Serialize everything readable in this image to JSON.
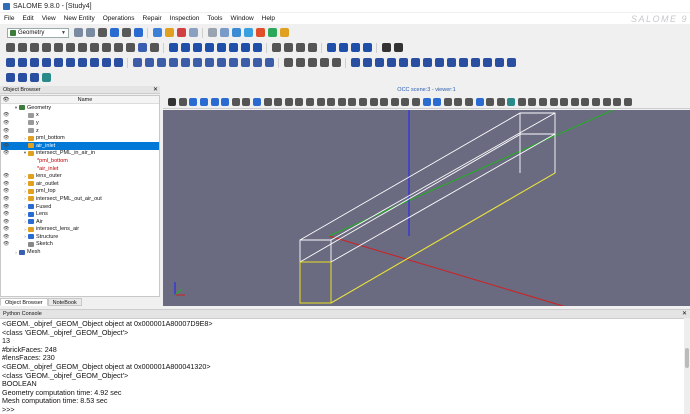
{
  "window": {
    "title": "SALOME 9.8.0 - [Study4]",
    "logo_text": "SALOME 9"
  },
  "menu": [
    "File",
    "Edit",
    "View",
    "New Entity",
    "Operations",
    "Repair",
    "Inspection",
    "Tools",
    "Window",
    "Help"
  ],
  "module_selector": {
    "value": "Geometry"
  },
  "toolbar_rows": [
    [
      "#7a8aa0",
      "#7a8aa0",
      "#5a5a5a",
      "#2a6bd1",
      "#5a5a5a",
      "#2a6bd1",
      "sep",
      "#3c7fd6",
      "#e0a020",
      "#d04040",
      "#8aa0c0",
      "sep",
      "#9aa3b0",
      "#7a9ac8",
      "#3b8bd4",
      "#3aa0e0",
      "#e04f2a",
      "#2ca85a",
      "#e0a020"
    ],
    [
      "#555",
      "#555",
      "#555",
      "#555",
      "#555",
      "#555",
      "#555",
      "#555",
      "#555",
      "#555",
      "#555",
      "#3a5fb0",
      "#555",
      "sep",
      "#1f4fa8",
      "#1f4fa8",
      "#1f4fa8",
      "#1f4fa8",
      "#1f4fa8",
      "#1f4fa8",
      "#1f4fa8",
      "#1f4fa8",
      "sep",
      "#555",
      "#555",
      "#555",
      "#555",
      "sep",
      "#1f4fa8",
      "#1f4fa8",
      "#1f4fa8",
      "#1f4fa8",
      "sep",
      "#333",
      "#333"
    ],
    [
      "#2a4fa0",
      "#2a4fa0",
      "#2a4fa0",
      "#2a4fa0",
      "#2a4fa0",
      "#2a4fa0",
      "#2a4fa0",
      "#2a4fa0",
      "#2a4fa0",
      "#2a4fa0",
      "sep",
      "#3d5da8",
      "#3d5da8",
      "#3d5da8",
      "#3d5da8",
      "#3d5da8",
      "#3d5da8",
      "#3d5da8",
      "#3d5da8",
      "#3d5da8",
      "#3d5da8",
      "#3d5da8",
      "#3d5da8",
      "sep",
      "#555",
      "#555",
      "#555",
      "#555",
      "#555",
      "sep",
      "#2a4fa0",
      "#2a4fa0",
      "#2a4fa0",
      "#2a4fa0",
      "#2a4fa0",
      "#2a4fa0",
      "#2a4fa0",
      "#2a4fa0",
      "#2a4fa0",
      "#2a4fa0",
      "#2a4fa0",
      "#2a4fa0",
      "#2a4fa0",
      "#2a4fa0"
    ],
    [
      "#2a4fa0",
      "#2a4fa0",
      "#2a4fa0",
      "#2a8a8a"
    ]
  ],
  "object_browser": {
    "title": "Object Browser",
    "column_name": "Name",
    "rows": [
      {
        "label": "Geometry",
        "indent": 0,
        "arrow": "▾",
        "eye": "",
        "icon": "#3b7c3b",
        "selected": false,
        "red": false
      },
      {
        "label": "x",
        "indent": 1,
        "arrow": "",
        "eye": "👁",
        "icon": "#9a9a9a",
        "selected": false,
        "red": false
      },
      {
        "label": "y",
        "indent": 1,
        "arrow": "",
        "eye": "👁",
        "icon": "#9a9a9a",
        "selected": false,
        "red": false
      },
      {
        "label": "z",
        "indent": 1,
        "arrow": "",
        "eye": "👁",
        "icon": "#9a9a9a",
        "selected": false,
        "red": false
      },
      {
        "label": "pml_bottom",
        "indent": 1,
        "arrow": "›",
        "eye": "👁",
        "icon": "#e0a020",
        "selected": false,
        "red": false
      },
      {
        "label": "air_inlet",
        "indent": 1,
        "arrow": "›",
        "eye": "👁",
        "icon": "#e0a020",
        "selected": true,
        "red": false
      },
      {
        "label": "intersect_PML_in_air_in",
        "indent": 1,
        "arrow": "▾",
        "eye": "👁",
        "icon": "#e0a020",
        "selected": false,
        "red": false
      },
      {
        "label": "pml_bottom",
        "indent": 2,
        "arrow": "",
        "eye": "",
        "icon": "",
        "selected": false,
        "red": true
      },
      {
        "label": "air_inlet",
        "indent": 2,
        "arrow": "",
        "eye": "",
        "icon": "",
        "selected": false,
        "red": true
      },
      {
        "label": "lens_outer",
        "indent": 1,
        "arrow": "›",
        "eye": "👁",
        "icon": "#e0a020",
        "selected": false,
        "red": false
      },
      {
        "label": "air_outlet",
        "indent": 1,
        "arrow": "›",
        "eye": "👁",
        "icon": "#e0a020",
        "selected": false,
        "red": false
      },
      {
        "label": "pml_top",
        "indent": 1,
        "arrow": "›",
        "eye": "👁",
        "icon": "#e0a020",
        "selected": false,
        "red": false
      },
      {
        "label": "intersect_PML_out_air_out",
        "indent": 1,
        "arrow": "›",
        "eye": "👁",
        "icon": "#e0a020",
        "selected": false,
        "red": false
      },
      {
        "label": "Fused",
        "indent": 1,
        "arrow": "›",
        "eye": "👁",
        "icon": "#2a6bd1",
        "selected": false,
        "red": false
      },
      {
        "label": "Lens",
        "indent": 1,
        "arrow": "›",
        "eye": "👁",
        "icon": "#2a6bd1",
        "selected": false,
        "red": false
      },
      {
        "label": "Air",
        "indent": 1,
        "arrow": "›",
        "eye": "👁",
        "icon": "#2a6bd1",
        "selected": false,
        "red": false
      },
      {
        "label": "intersect_lens_air",
        "indent": 1,
        "arrow": "›",
        "eye": "👁",
        "icon": "#e0a020",
        "selected": false,
        "red": false
      },
      {
        "label": "Structure",
        "indent": 1,
        "arrow": "›",
        "eye": "👁",
        "icon": "#2a6bd1",
        "selected": false,
        "red": false
      },
      {
        "label": "Sketch",
        "indent": 1,
        "arrow": "",
        "eye": "👁",
        "icon": "#888888",
        "selected": false,
        "red": false
      },
      {
        "label": "Mesh",
        "indent": 0,
        "arrow": "›",
        "eye": "",
        "icon": "#3a5fb0",
        "selected": false,
        "red": false
      }
    ]
  },
  "left_tabs": [
    {
      "label": "Object Browser",
      "active": true
    },
    {
      "label": "NoteBook",
      "active": false
    }
  ],
  "viewer": {
    "title": "OCC scene:3 - viewer:1",
    "toolbar": [
      "#333",
      "#555",
      "#2a6bd1",
      "#2a6bd1",
      "#2a6bd1",
      "#2a6bd1",
      "#555",
      "#555",
      "#2a6bd1",
      "#555",
      "#555",
      "#555",
      "#555",
      "#555",
      "#555",
      "#555",
      "#555",
      "#555",
      "#555",
      "#555",
      "#555",
      "#555",
      "#555",
      "#555",
      "#2a6bd1",
      "#2a6bd1",
      "#555",
      "#555",
      "#555",
      "#2a6bd1",
      "#555",
      "#555",
      "#2a8a8a",
      "#555",
      "#555",
      "#555",
      "#555",
      "#555",
      "#555",
      "#555",
      "#555",
      "#555",
      "#555",
      "#555"
    ],
    "axis_colors": {
      "x": "#d02020",
      "y": "#20b020",
      "z": "#2020ff"
    },
    "box_color": "#ffffff",
    "highlight_color": "#e8e020"
  },
  "console": {
    "title": "Python Console",
    "lines": [
      "<GEOM._objref_GEOM_Object object at 0x000001A80007D9E8>",
      "<class 'GEOM._objref_GEOM_Object'>",
      "13",
      "#brickFaces: 248",
      "#lensFaces: 230",
      "<GEOM._objref_GEOM_Object object at 0x000001A800041320>",
      "<class 'GEOM._objref_GEOM_Object'>",
      "BOOLEAN",
      "Geometry computation time: 4.92 sec",
      "Mesh computation time: 8.53 sec",
      ">>>"
    ]
  }
}
